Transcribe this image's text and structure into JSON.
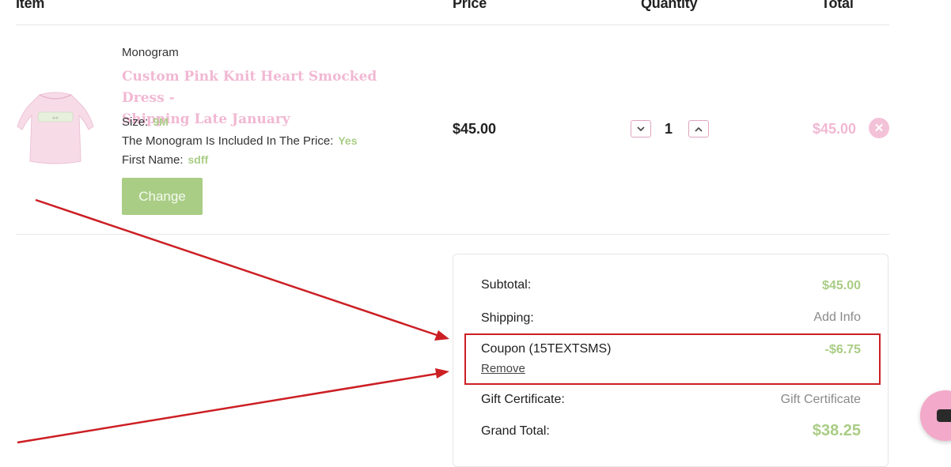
{
  "header": {
    "item": "Item",
    "price": "Price",
    "quantity": "Quantity",
    "total": "Total"
  },
  "cart_item": {
    "brand": "Monogram",
    "name_line1": "Custom Pink Knit Heart Smocked Dress -",
    "name_line2": "Shipping Late January",
    "options": [
      {
        "label": "Size:",
        "value": "9M"
      },
      {
        "label": "The Monogram Is Included In The Price:",
        "value": "Yes"
      },
      {
        "label": "First Name:",
        "value": "sdff"
      }
    ],
    "change_label": "Change",
    "price": "$45.00",
    "quantity": "1",
    "line_total": "$45.00"
  },
  "summary": {
    "subtotal_label": "Subtotal:",
    "subtotal_value": "$45.00",
    "shipping_label": "Shipping:",
    "shipping_value": "Add Info",
    "coupon_label": "Coupon (15TEXTSMS)",
    "coupon_value": "-$6.75",
    "coupon_remove": "Remove",
    "gift_label": "Gift Certificate:",
    "gift_value": "Gift Certificate",
    "grand_label": "Grand Total:",
    "grand_value": "$38.25"
  },
  "colors": {
    "accent_green": "#a9cd85",
    "accent_pink": "#f1b8d3",
    "annotation_red": "#cc1f24"
  },
  "icons": {
    "decrease": "chevron-down-icon",
    "increase": "chevron-up-icon",
    "remove": "close-icon",
    "chat": "chat-icon"
  }
}
